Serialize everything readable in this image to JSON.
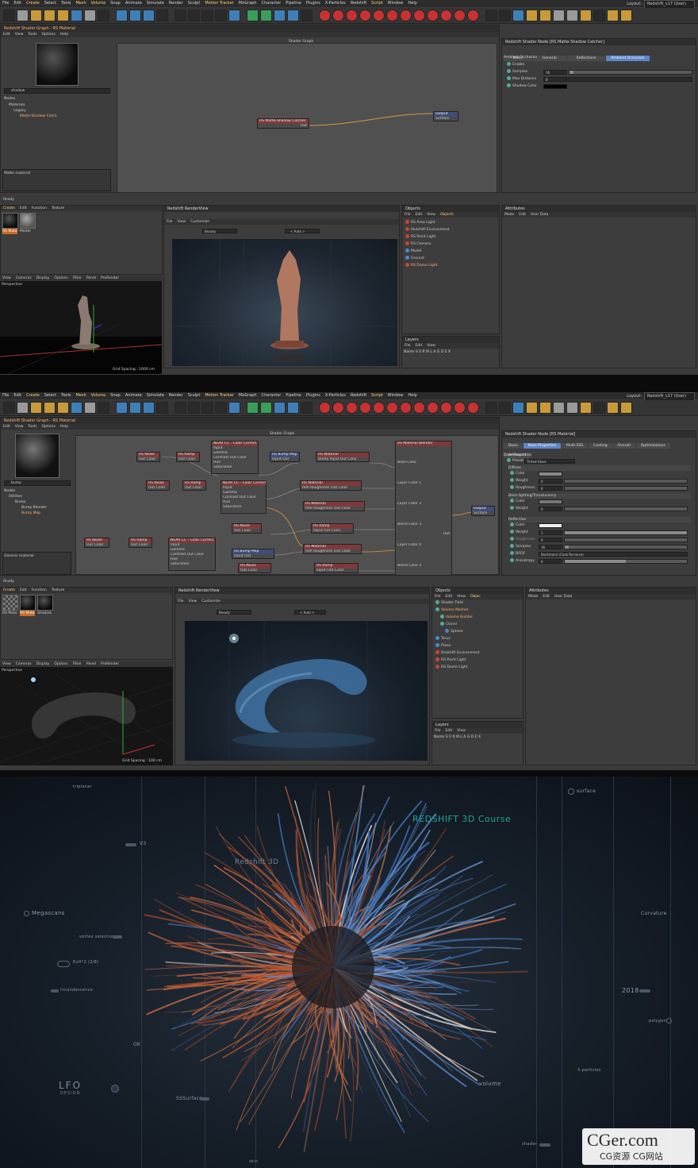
{
  "menu": [
    "File",
    "Edit",
    "Create",
    "Select",
    "Tools",
    "Mesh",
    "Volume",
    "Snap",
    "Animate",
    "Simulate",
    "Render",
    "Sculpt",
    "Motion Tracker",
    "MoGraph",
    "Character",
    "Pipeline",
    "Plugins",
    "X-Particles",
    "Redshift",
    "Script",
    "Window",
    "Help"
  ],
  "layout_label": "Layout:",
  "layout_value": "Redshift_v17 (User)",
  "s1": {
    "shader_title": "Redshift Shader Graph - RS Material",
    "shader_menu": [
      "Edit",
      "View",
      "Tools",
      "Options",
      "Help"
    ],
    "graph_title": "Shader Graph",
    "search": "shadow",
    "tree_header": "Nodes",
    "tree": [
      "Materials",
      "Legacy",
      "Matte-Shadow Catch"
    ],
    "desc": "Matte material",
    "node1_title": "RS Matte-Shadow Catcher",
    "node1_port": "Out",
    "output_title": "Output",
    "output_port": "Surface",
    "attr_title": "Redshift Shader Node [RS Matte-Shadow Catcher]",
    "tabs": [
      "Basic",
      "General",
      "Reflections",
      "Ambient Occlusion"
    ],
    "section": "Ambient Occlusion",
    "props": [
      {
        "label": "Enable",
        "value": ""
      },
      {
        "label": "Samples",
        "value": "16"
      },
      {
        "label": "Max Distance",
        "value": "0"
      },
      {
        "label": "Shadow Color",
        "value": ""
      }
    ],
    "ready": "Ready",
    "mat_menu": [
      "Create",
      "Edit",
      "Function",
      "Texture"
    ],
    "mats": [
      "RS Mate",
      "Model"
    ],
    "vp_menu": [
      "View",
      "Cameras",
      "Display",
      "Options",
      "Filter",
      "Panel",
      "ProRender"
    ],
    "vp_label": "Perspective",
    "grid_spacing": "Grid Spacing : 1000 cm",
    "rv_title": "Redshift RenderView",
    "rv_menu": [
      "File",
      "View",
      "Customize"
    ],
    "rv_mode": "Beauty",
    "rv_auto": "< Auto >",
    "obj_title": "Objects",
    "obj_menu": [
      "File",
      "Edit",
      "View",
      "Objects"
    ],
    "objects": [
      "RS Area Light",
      "Redshift Environment",
      "RS Point Light",
      "RS Camera",
      "Model",
      "Ground",
      "RS Dome Light"
    ],
    "layers_title": "Layers",
    "layers_menu": [
      "File",
      "Edit",
      "View"
    ],
    "layers_cols": "Name    S V R M L A G D E X",
    "attrs_title": "Attributes",
    "attrs_menu": [
      "Mode",
      "Edit",
      "User Data"
    ]
  },
  "s2": {
    "shader_title": "Redshift Shader Graph - RS Material",
    "shader_menu": [
      "Edit",
      "View",
      "Tools",
      "Options",
      "Help"
    ],
    "graph_title": "Shader Graph",
    "search": "bump",
    "tree_header": "Nodes",
    "tree": [
      "Utilities",
      "Bump",
      "Bump Blender",
      "Bump Map"
    ],
    "desc": "Generic material",
    "nodes": [
      {
        "t": "RS Noise",
        "p": "Out Color"
      },
      {
        "t": "RS Ramp",
        "p": "Out Color"
      },
      {
        "t": "NEAR CC - Color Correct",
        "p": "Input"
      },
      {
        "t": "RS Bump Map",
        "p": "Input   Out"
      },
      {
        "t": "RS Material",
        "p": "Bump Input   Out Color"
      },
      {
        "t": "RS Noise",
        "p": "Out Color"
      },
      {
        "t": "RS Ramp",
        "p": "Out Color"
      },
      {
        "t": "NEAR CC - Color Correct",
        "p": "Input"
      },
      {
        "t": "RS Material",
        "p": "Refl Roughness   Out Color"
      },
      {
        "t": "RS Material",
        "p": "Refl Roughness   Out Color"
      },
      {
        "t": "RS Noise",
        "p": "Out Color"
      },
      {
        "t": "RS Ramp",
        "p": "Input   Out Color"
      },
      {
        "t": "RS Noise",
        "p": "Out Color"
      },
      {
        "t": "RS Ramp",
        "p": "Out Color"
      },
      {
        "t": "NEAR CC - Color Correct",
        "p": "Input"
      },
      {
        "t": "RS Bump Map",
        "p": "Input   Out"
      },
      {
        "t": "RS Material",
        "p": "Refl Roughness   Out Color"
      },
      {
        "t": "RS Noise",
        "p": "Out Color"
      },
      {
        "t": "RS Ramp",
        "p": "Input   Out Color"
      }
    ],
    "cc_ports": [
      "Gamma",
      "Contrast  Out Color",
      "Hue",
      "Saturation"
    ],
    "blender_title": "RS Material Blender",
    "blender_ports": [
      "Base Color",
      "Layer Color 1",
      "Layer Color 3",
      "Blend Color 3",
      "Layer Color 4",
      "Blend Color 4"
    ],
    "blender_out": "Out",
    "output_title": "Output",
    "output_port": "Surface",
    "attr_title": "Redshift Shader Node [RS Material]",
    "tabs": [
      "Basic",
      "Base Properties",
      "Multi-SSS",
      "Coating",
      "Overall",
      "Optimizations",
      "Advanced"
    ],
    "section": "Base Properties",
    "preset_label": "Preset",
    "preset_value": "Tinted Glass",
    "diffuse": "Diffuse",
    "diffuse_props": [
      "Color",
      "Weight",
      "Roughness"
    ],
    "diffuse_vals": [
      "",
      "0",
      "0"
    ],
    "back": "Back-lighting/Translucency",
    "back_props": [
      "Color",
      "Weight"
    ],
    "back_vals": [
      "",
      "0"
    ],
    "refl": "Reflection",
    "refl_props": [
      "Color",
      "Weight",
      "Roughness",
      "Samples",
      "BRDF",
      "Anisotropy"
    ],
    "refl_vals": [
      "",
      "1",
      "0",
      "16",
      "Beckmann (Cook-Torrance)",
      "0"
    ],
    "ready": "Ready",
    "mat_menu": [
      "Create",
      "Edit",
      "Function",
      "Texture"
    ],
    "mats": [
      "RS Mate",
      "RS Mate",
      "Shadow"
    ],
    "vp_menu": [
      "View",
      "Cameras",
      "Display",
      "Options",
      "Filter",
      "Panel",
      "ProRender"
    ],
    "vp_label": "Perspective",
    "grid_spacing": "Grid Spacing : 100 cm",
    "rv_title": "Redshift RenderView",
    "rv_menu": [
      "File",
      "View",
      "Customize"
    ],
    "rv_mode": "Beauty",
    "rv_auto": "< Auto >",
    "obj_title": "Objects",
    "obj_menu": [
      "File",
      "Edit",
      "View",
      "Objec"
    ],
    "objects": [
      "Shader Field",
      "Volume Mesher",
      "Volume Builder",
      "Cloner",
      "Sphere",
      "Torus",
      "Plane",
      "Redshift Environment",
      "RS Point Light",
      "RS Dome Light"
    ],
    "layers_title": "Layers",
    "layers_menu": [
      "File",
      "Edit",
      "View"
    ],
    "layers_cols": "Name    S V R M L A G D E X",
    "attrs_title": "Attributes",
    "attrs_menu": [
      "Mode",
      "Edit",
      "User Data"
    ]
  },
  "s3": {
    "heading": "REDSHIFT 3D Course",
    "sub": "Redshift 3D",
    "labels": [
      "triplanar",
      "V3",
      "Megascans",
      "vertex selection",
      "ExH*2 (2/8)",
      "incandescence",
      "OK",
      "SSSurface",
      "skin",
      "surface",
      "Curvature",
      "2018",
      "polygon",
      "X-particles",
      "volume",
      "shader"
    ],
    "logo_line1": "LFO",
    "logo_line2": "DESIGN",
    "wm_main": "CGer.com",
    "wm_sub": "CG资源 CG网站"
  },
  "colors": {
    "accent": "#5d86c7",
    "node_header": "#7e3a3a",
    "wire": "#d89a3a",
    "cyan": "#22a39a"
  }
}
